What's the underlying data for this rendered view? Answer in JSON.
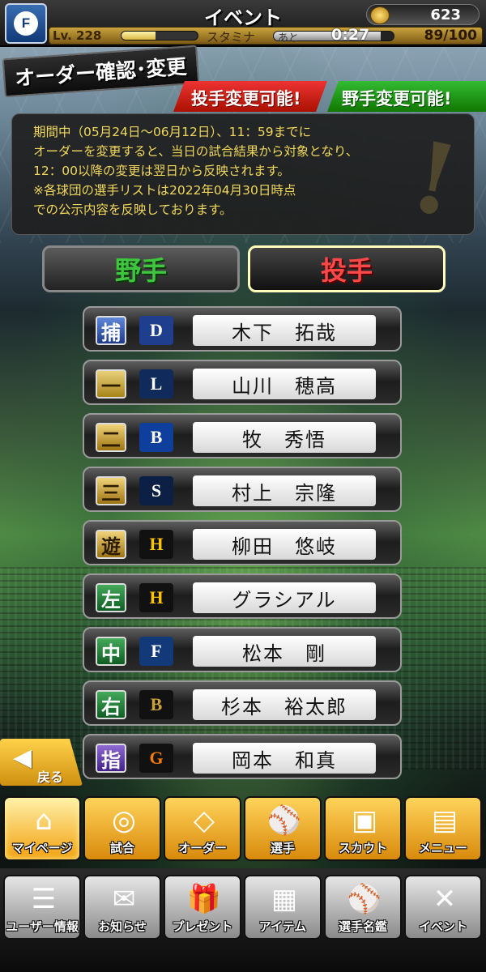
{
  "header": {
    "title": "イベント",
    "coins": "623",
    "level_label": "Lv. 228",
    "exp_progress": 0.45,
    "stamina_label": "スタミナ",
    "recovery_label": "あと",
    "recovery_time": "0:27",
    "stamina_value": "89/100",
    "stamina_progress": 0.89
  },
  "banner": {
    "title": "オーダー確認･変更",
    "pitcher_change": "投手変更可能!",
    "fielder_change": "野手変更可能!"
  },
  "notice": {
    "text": "期間中（05月24日～06月12日）、11：59までに\nオーダーを変更すると、当日の試合結果から対象となり、\n12：00以降の変更は翌日から反映されます。\n※各球団の選手リストは2022年04月30日時点\nでの公示内容を反映しております。"
  },
  "tabs": {
    "fielders": "野手",
    "pitchers": "投手"
  },
  "roster": [
    {
      "position": "捕",
      "team_icon": "dragons-logo",
      "name": "木下　拓哉"
    },
    {
      "position": "一",
      "team_icon": "lions-logo",
      "name": "山川　穂高"
    },
    {
      "position": "二",
      "team_icon": "baystars-logo",
      "name": "牧　秀悟"
    },
    {
      "position": "三",
      "team_icon": "swallows-logo",
      "name": "村上　宗隆"
    },
    {
      "position": "遊",
      "team_icon": "hawks-logo",
      "name": "柳田　悠岐"
    },
    {
      "position": "左",
      "team_icon": "hawks-logo",
      "name": "グラシアル"
    },
    {
      "position": "中",
      "team_icon": "fighters-logo",
      "name": "松本　剛"
    },
    {
      "position": "右",
      "team_icon": "buffaloes-logo",
      "name": "杉本　裕太郎"
    },
    {
      "position": "指",
      "team_icon": "giants-logo",
      "name": "岡本　和真"
    }
  ],
  "back_label": "戻る",
  "nav_primary": [
    {
      "label": "マイページ",
      "icon": "home-icon"
    },
    {
      "label": "試合",
      "icon": "stadium-icon"
    },
    {
      "label": "オーダー",
      "icon": "field-icon"
    },
    {
      "label": "選手",
      "icon": "player-icon"
    },
    {
      "label": "スカウト",
      "icon": "card-icon"
    },
    {
      "label": "メニュー",
      "icon": "menu-icon"
    }
  ],
  "nav_secondary": [
    {
      "label": "ユーザー情報",
      "icon": "user-info-icon"
    },
    {
      "label": "お知らせ",
      "icon": "notice-icon"
    },
    {
      "label": "プレゼント",
      "icon": "gift-icon"
    },
    {
      "label": "アイテム",
      "icon": "item-icon"
    },
    {
      "label": "選手名鑑",
      "icon": "directory-icon"
    },
    {
      "label": "イベント",
      "icon": "event-icon"
    }
  ],
  "colors": {
    "notice_text": "#f1d85b",
    "pitcher_tab": "#ff4848",
    "fielder_tab": "#3ec63e",
    "gold": "#d09010"
  }
}
